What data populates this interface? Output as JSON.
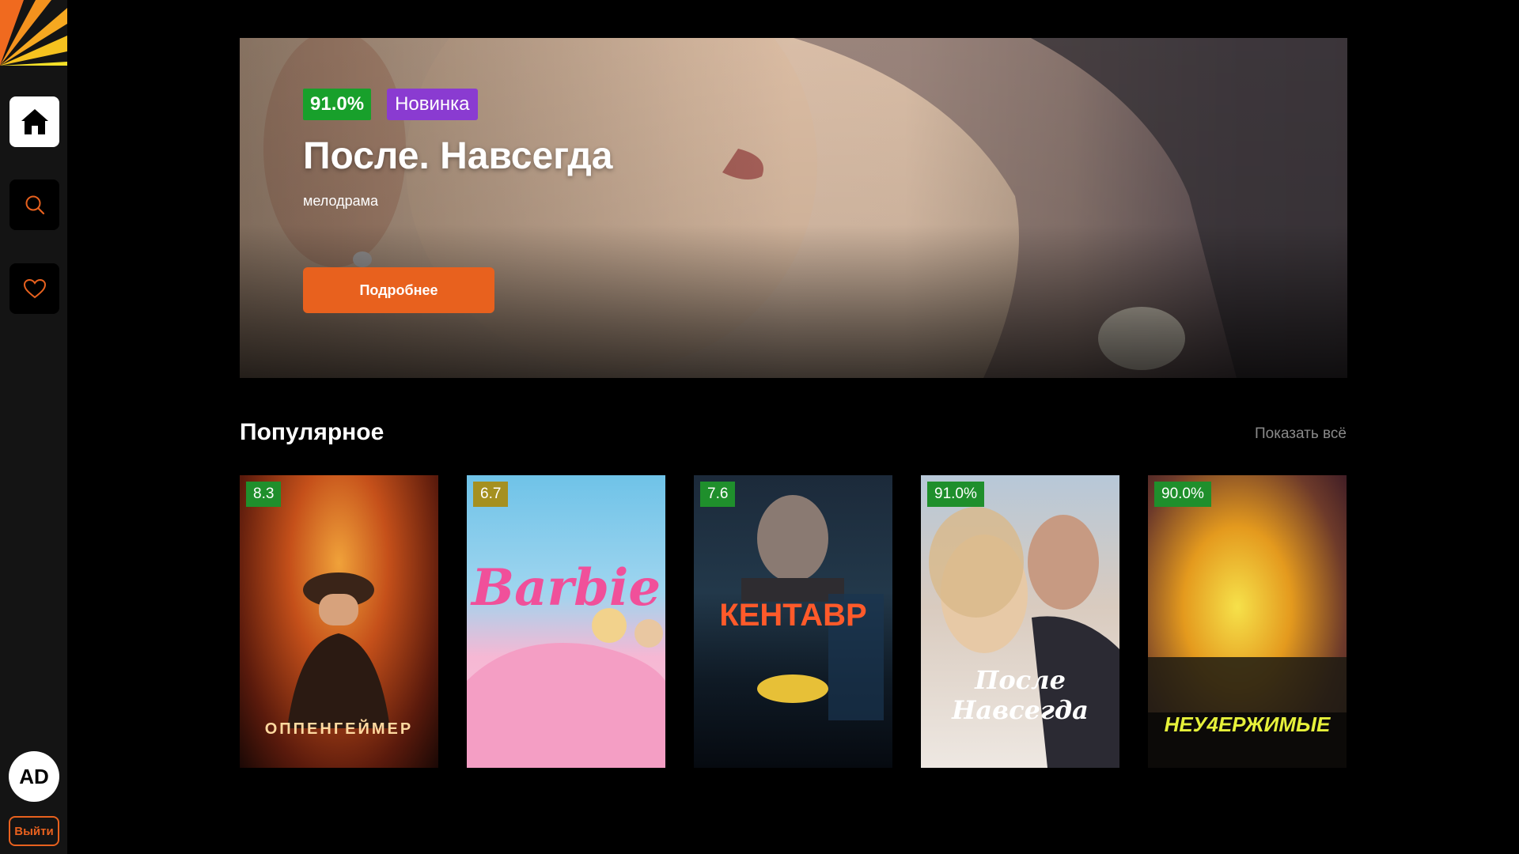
{
  "sidebar": {
    "nav": [
      {
        "name": "home",
        "icon": "home-icon",
        "active": true
      },
      {
        "name": "search",
        "icon": "search-icon",
        "active": false
      },
      {
        "name": "favorites",
        "icon": "heart-icon",
        "active": false
      }
    ],
    "avatar_initials": "AD",
    "logout_label": "Выйти"
  },
  "hero": {
    "rating": "91.0%",
    "badge": "Новинка",
    "title": "После. Навсегда",
    "genre": "мелодрама",
    "button_label": "Подробнее"
  },
  "popular": {
    "title": "Популярное",
    "show_all": "Показать всё",
    "items": [
      {
        "rating": "8.3",
        "rating_color": "#1f8f2c",
        "poster_text": "ОППЕНГЕЙМЕР"
      },
      {
        "rating": "6.7",
        "rating_color": "#a59020",
        "poster_text": "Barbie"
      },
      {
        "rating": "7.6",
        "rating_color": "#1f8f2c",
        "poster_text": "КЕНТАВР"
      },
      {
        "rating": "91.0%",
        "rating_color": "#1f8f2c",
        "poster_text": "После Навсегда"
      },
      {
        "rating": "90.0%",
        "rating_color": "#1f8f2c",
        "poster_text": "НЕУ4ЕРЖИМЫЕ"
      }
    ]
  },
  "colors": {
    "accent": "#e8611e",
    "rating_green": "#18a02b",
    "new_badge_purple": "#8a3bd1"
  }
}
